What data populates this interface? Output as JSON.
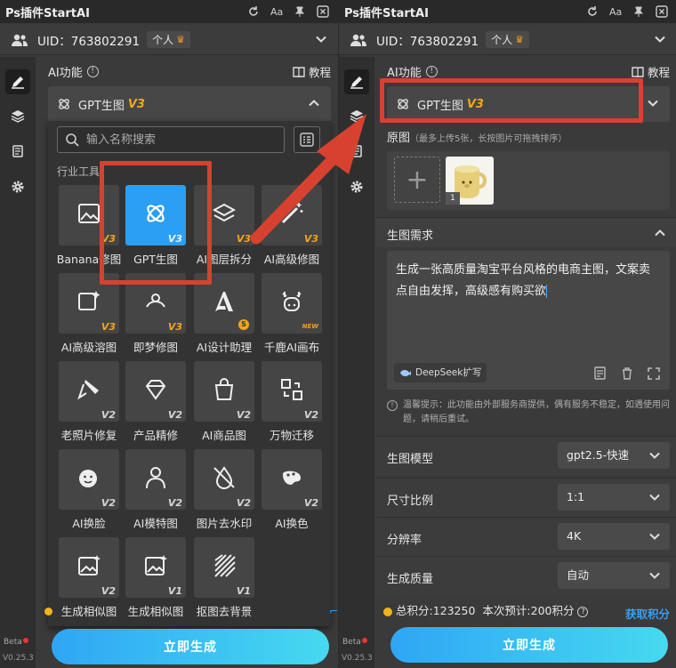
{
  "app": {
    "title": "Ps插件StartAI",
    "top_icons": [
      "refresh-icon",
      "font-size-icon",
      "pin-icon",
      "close-icon"
    ],
    "font_size_label": "Aa",
    "uid_label": "UID：763802291",
    "account_badge": "个人",
    "version_label": "V0.25.3",
    "beta_label": "Beta",
    "colors": {
      "accent": "#2b9ff3",
      "highlight": "#d6422f",
      "tag_gold": "#f3a61b"
    }
  },
  "section": {
    "title": "AI功能",
    "tutorial": "教程"
  },
  "selected_tool": {
    "name": "GPT生图",
    "tag": "V3"
  },
  "left_panel": {
    "search_placeholder": "输入名称搜索",
    "category": "行业工具",
    "tools": [
      {
        "name": "Banana修图",
        "tag": "V3",
        "icon": "image-icon"
      },
      {
        "name": "GPT生图",
        "tag": "V3",
        "icon": "gpt-icon",
        "selected": true
      },
      {
        "name": "AI图层拆分",
        "tag": "V3",
        "icon": "layer-split-icon"
      },
      {
        "name": "AI高级修图",
        "tag": "V3",
        "icon": "magic-wand-icon"
      },
      {
        "name": "AI高级溶图",
        "tag": "V3",
        "icon": "blend-icon"
      },
      {
        "name": "即梦修图",
        "tag": "V3",
        "icon": "dream-icon"
      },
      {
        "name": "AI设计助理",
        "tag": "S",
        "icon": "design-a-icon"
      },
      {
        "name": "千鹿AI画布",
        "tag": "NEW",
        "icon": "deer-icon"
      },
      {
        "name": "老照片修复",
        "tag": "V2",
        "icon": "brush-icon"
      },
      {
        "name": "产品精修",
        "tag": "V2",
        "icon": "gem-icon"
      },
      {
        "name": "AI商品图",
        "tag": "V2",
        "icon": "shopping-bag-icon"
      },
      {
        "name": "万物迁移",
        "tag": "V2",
        "icon": "transfer-icon"
      },
      {
        "name": "AI换脸",
        "tag": "V2",
        "icon": "face-icon"
      },
      {
        "name": "AI模特图",
        "tag": "V2",
        "icon": "model-icon"
      },
      {
        "name": "图片去水印",
        "tag": "V2",
        "icon": "no-watermark-icon"
      },
      {
        "name": "AI换色",
        "tag": "V2",
        "icon": "recolor-icon"
      },
      {
        "name": "生成相似图",
        "tag": "V2",
        "icon": "image-sparkle-icon"
      },
      {
        "name": "生成相似图",
        "tag": "V1",
        "icon": "image-sparkle-icon"
      },
      {
        "name": "抠图去背景",
        "tag": "V1",
        "icon": "cutout-icon"
      }
    ]
  },
  "right_panel": {
    "source_label": "原图",
    "source_hint": "（最多上传5张，长按图片可拖拽排序）",
    "thumb_index": "1",
    "request_title": "生图需求",
    "request_text": "生成一张高质量淘宝平台风格的电商主图，文案卖点自由发挥，高级感有购买欲",
    "deepseek_label": "DeepSeek扩写",
    "tip_text": "温馨提示：此功能由外部服务商提供，偶有服务不稳定，如遇使用问题，请稍后重试。",
    "settings": [
      {
        "label": "生图模型",
        "value": "gpt2.5-快速"
      },
      {
        "label": "尺寸比例",
        "value": "1:1"
      },
      {
        "label": "分辨率",
        "value": "4K"
      },
      {
        "label": "生成质量",
        "value": "自动"
      }
    ],
    "points_total": "总积分:123250",
    "points_estimate": "本次预计:200积分",
    "get_points": "获取积分"
  },
  "generate_button": "立即生成"
}
